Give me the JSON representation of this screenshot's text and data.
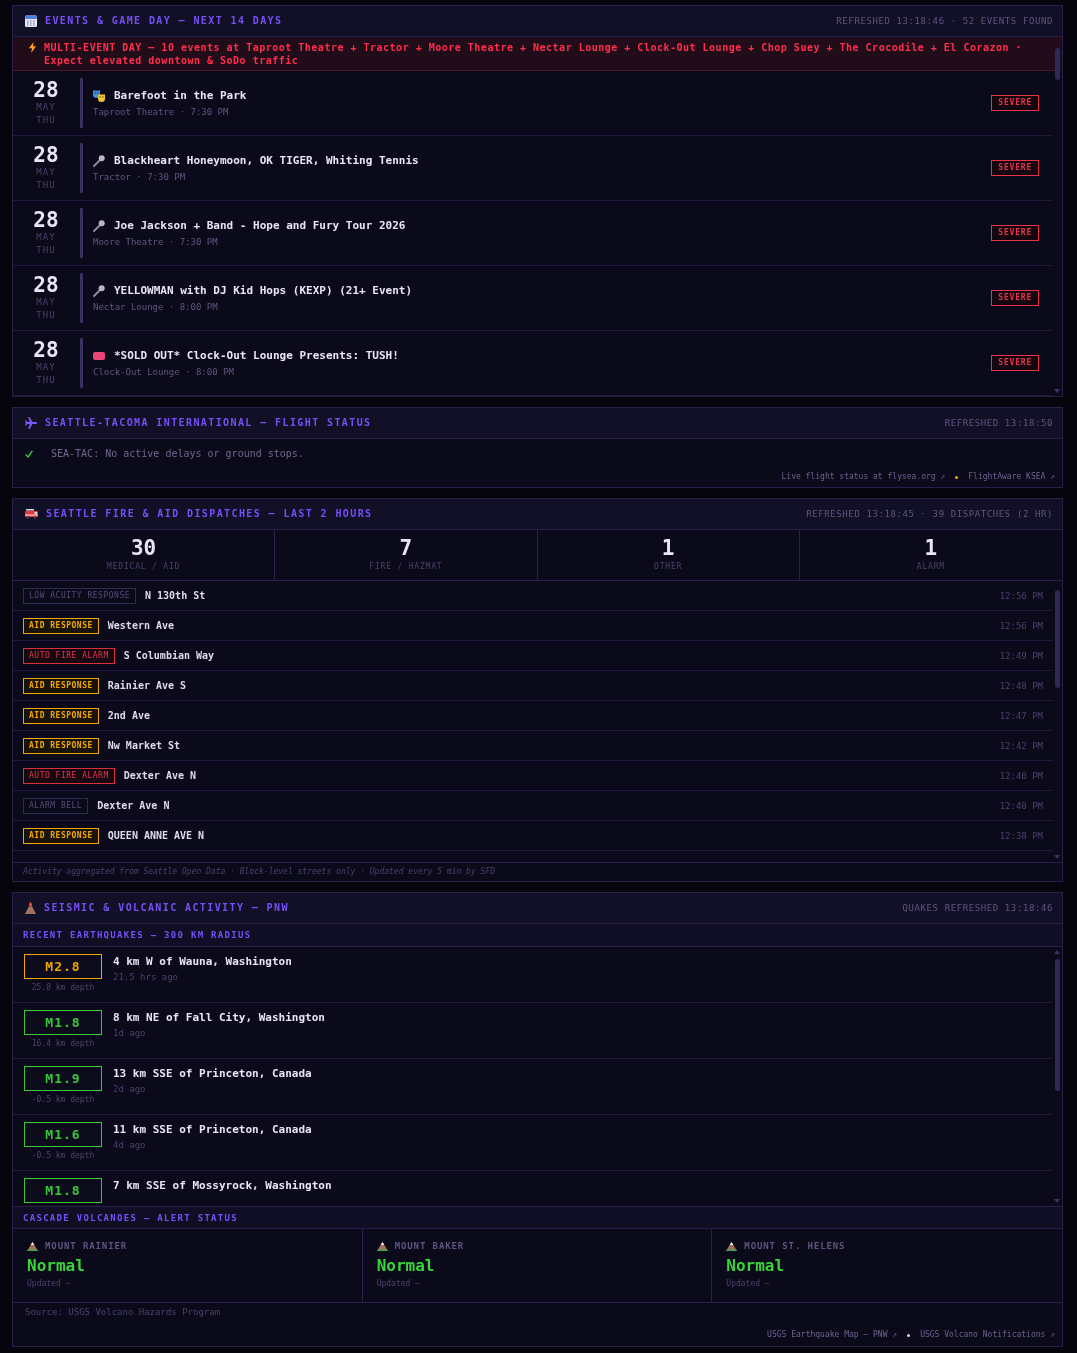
{
  "events_panel": {
    "title": "EVENTS & GAME DAY — NEXT 14 DAYS",
    "status": "REFRESHED 13:18:46 · 52 EVENTS FOUND",
    "alert": "MULTI-EVENT DAY — 10 events at Taproot Theatre + Tractor + Moore Theatre + Nectar Lounge + Clock-Out Lounge + Chop Suey + The Crocodile + El Corazon · Expect elevated downtown & SoDo traffic",
    "events": [
      {
        "day": "28",
        "month": "MAY",
        "weekday": "THU",
        "kind": "theatre",
        "title": "Barefoot in the Park",
        "meta": "Taproot Theatre · 7:30 PM",
        "badge": "SEVERE"
      },
      {
        "day": "28",
        "month": "MAY",
        "weekday": "THU",
        "kind": "concert",
        "title": "Blackheart Honeymoon, OK TIGER, Whiting Tennis",
        "meta": "Tractor · 7:30 PM",
        "badge": "SEVERE"
      },
      {
        "day": "28",
        "month": "MAY",
        "weekday": "THU",
        "kind": "concert",
        "title": "Joe Jackson + Band - Hope and Fury Tour 2026",
        "meta": "Moore Theatre · 7:30 PM",
        "badge": "SEVERE"
      },
      {
        "day": "28",
        "month": "MAY",
        "weekday": "THU",
        "kind": "concert",
        "title": "YELLOWMAN with DJ Kid Hops (KEXP) (21+ Event)",
        "meta": "Nectar Lounge · 8:00 PM",
        "badge": "SEVERE"
      },
      {
        "day": "28",
        "month": "MAY",
        "weekday": "THU",
        "kind": "ticket",
        "title": "*SOLD OUT* Clock-Out Lounge Presents: TUSH!",
        "meta": "Clock-Out Lounge · 8:00 PM",
        "badge": "SEVERE"
      }
    ]
  },
  "flight_panel": {
    "title": "SEATTLE-TACOMA INTERNATIONAL — FLIGHT STATUS",
    "status": "REFRESHED 13:18:50",
    "message": "SEA-TAC: No active delays or ground stops.",
    "links": [
      "Live flight status at flysea.org ↗",
      "FlightAware KSEA ↗"
    ]
  },
  "fire_panel": {
    "title": "SEATTLE FIRE & AID DISPATCHES — LAST 2 HOURS",
    "status": "REFRESHED 13:18:45 · 39 DISPATCHES (2 HR)",
    "stats": [
      {
        "value": "30",
        "label": "MEDICAL / AID"
      },
      {
        "value": "7",
        "label": "FIRE / HAZMAT"
      },
      {
        "value": "1",
        "label": "OTHER"
      },
      {
        "value": "1",
        "label": "ALARM"
      }
    ],
    "dispatches": [
      {
        "type": "LOW ACUITY RESPONSE",
        "kind": "low",
        "address": "N 130th St",
        "time": "12:56 PM"
      },
      {
        "type": "AID RESPONSE",
        "kind": "medium",
        "address": "Western Ave",
        "time": "12:56 PM"
      },
      {
        "type": "AUTO FIRE ALARM",
        "kind": "high",
        "address": "S Columbian Way",
        "time": "12:49 PM"
      },
      {
        "type": "AID RESPONSE",
        "kind": "medium",
        "address": "Rainier Ave S",
        "time": "12:48 PM"
      },
      {
        "type": "AID RESPONSE",
        "kind": "medium",
        "address": "2nd Ave",
        "time": "12:47 PM"
      },
      {
        "type": "AID RESPONSE",
        "kind": "medium",
        "address": "Nw Market St",
        "time": "12:42 PM"
      },
      {
        "type": "AUTO FIRE ALARM",
        "kind": "high",
        "address": "Dexter Ave N",
        "time": "12:40 PM"
      },
      {
        "type": "ALARM BELL",
        "kind": "low",
        "address": "Dexter Ave N",
        "time": "12:40 PM"
      },
      {
        "type": "AID RESPONSE",
        "kind": "medium",
        "address": "QUEEN ANNE AVE N",
        "time": "12:38 PM"
      }
    ],
    "footer": "Activity aggregated from Seattle Open Data · Block-level streets only · Updated every 5 min by SFD"
  },
  "seismic_panel": {
    "title": "SEISMIC & VOLCANIC ACTIVITY — PNW",
    "status": "QUAKES REFRESHED 13:18:46",
    "quakes_heading": "RECENT EARTHQUAKES — 300 KM RADIUS",
    "quakes": [
      {
        "magnitude": "M2.8",
        "color": "#f0a500",
        "depth": "25.8 km depth",
        "place": "4 km W of Wauna, Washington",
        "ago": "21.5 hrs ago"
      },
      {
        "magnitude": "M1.8",
        "color": "#35c935",
        "depth": "16.4 km depth",
        "place": "8 km NE of Fall City, Washington",
        "ago": "1d ago"
      },
      {
        "magnitude": "M1.9",
        "color": "#35c935",
        "depth": "-0.5 km depth",
        "place": "13 km SSE of Princeton, Canada",
        "ago": "2d ago"
      },
      {
        "magnitude": "M1.6",
        "color": "#35c935",
        "depth": "-0.5 km depth",
        "place": "11 km SSE of Princeton, Canada",
        "ago": "4d ago"
      },
      {
        "magnitude": "M1.8",
        "color": "#35c935",
        "place": "7 km SSE of Mossyrock, Washington"
      }
    ],
    "volcanoes_heading": "CASCADE VOLCANOES — ALERT STATUS",
    "volcanoes": [
      {
        "name": "MOUNT RAINIER",
        "status": "Normal",
        "kind": "normal",
        "updated": "Updated —"
      },
      {
        "name": "MOUNT BAKER",
        "status": "Normal",
        "kind": "normal",
        "updated": "Updated —"
      },
      {
        "name": "MOUNT ST. HELENS",
        "status": "Normal",
        "kind": "normal",
        "updated": "Updated —"
      }
    ],
    "source": "Source: USGS Volcano Hazards Program",
    "links": [
      "USGS Earthquake Map — PNW ↗",
      "USGS Volcano Notifications ↗"
    ]
  }
}
